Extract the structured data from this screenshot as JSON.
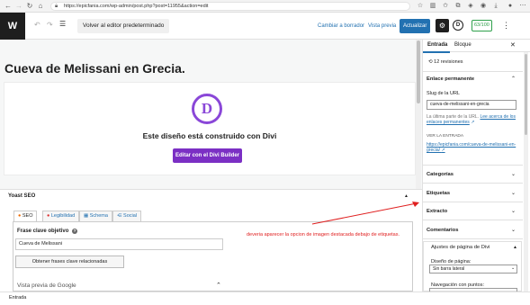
{
  "browser": {
    "url": "https://epicfania.com/wp-admin/post.php?post=11955&action=edit",
    "icons": [
      "back-icon",
      "refresh-icon",
      "home-icon",
      "lock-icon",
      "star-icon",
      "collections-icon",
      "profile-icon",
      "more-icon"
    ]
  },
  "header": {
    "logo": "W",
    "editor_button": "Volver al editor predeterminado",
    "draft": "Cambiar a borrador",
    "preview": "Vista previa",
    "publish": "Actualizar",
    "seo_badge": "63/100"
  },
  "post": {
    "title": "Cueva de Melissani en Grecia."
  },
  "divi": {
    "logo": "D",
    "message": "Este diseño está construido con Divi",
    "button": "Editar con el Divi Builder",
    "accent": "#7b2fc4"
  },
  "yoast": {
    "title": "Yoast SEO",
    "tabs": [
      "SEO",
      "Legibilidad",
      "Schema",
      "Social"
    ],
    "focus_label": "Frase clave objetivo",
    "focus_value": "Cueva de Melissani",
    "related_button": "Obtener frases clave relacionadas",
    "google_preview": "Vista previa de Google"
  },
  "annotation": "deveria aparecer la opcion de imagen destacada debajo de etiquetas.",
  "sidebar": {
    "tab_post": "Entrada",
    "tab_block": "Bloque",
    "revisions": "12 revisiones",
    "permalink_title": "Enlace permanente",
    "slug_label": "Slug de la URL",
    "slug_value": "cueva-de-melissani-en-grecia",
    "slug_help": "La última parte de la URL.",
    "slug_help_link": "Lee acerca de los enlaces permanentes",
    "view_label": "VER LA ENTRADA",
    "permalink_url": "https://epicfania.com/cueva-de-melissani-en-grecia/",
    "sections": [
      "Categorías",
      "Etiquetas",
      "Extracto",
      "Comentarios"
    ],
    "layout_title": "Ajustes de página de Divi",
    "design_label": "Diseño de página:",
    "design_value": "Sin barra lateral",
    "nav_label": "Navegación con puntos:"
  },
  "footer": {
    "breadcrumb": "Entrada"
  }
}
